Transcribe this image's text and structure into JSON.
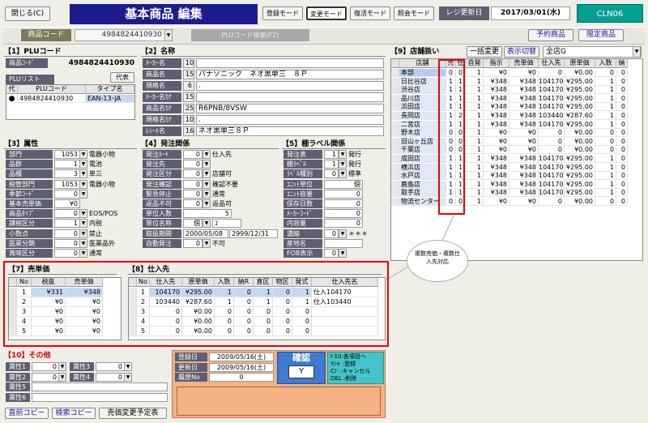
{
  "toolbar": {
    "close": "閉じる(C)",
    "title": "基本商品 編集",
    "modes": [
      "登録モード",
      "変更モード",
      "復活モード",
      "照会モード"
    ],
    "register_date_label": "レジ更新日",
    "register_date": "2017/03/01(水)",
    "user": "CLN06"
  },
  "product_code": {
    "label": "商品コード",
    "value": "4984824410930",
    "search_button": "PLUコード検索(F2)",
    "reserve_button": "予約商品",
    "limited_button": "限定商品"
  },
  "plu": {
    "header": "【1】PLUコード",
    "code_label": "商品ｺｰﾄﾞ",
    "code_value": "4984824410930",
    "list_label": "PLUリスト",
    "rep_label": "代表",
    "columns": [
      "代",
      "PLUコード",
      "タイプ名"
    ],
    "rows": [
      {
        "rep": "●",
        "code": "4984824410930",
        "type": "EAN-13･JA"
      }
    ]
  },
  "names": {
    "header": "【2】名称",
    "rows": [
      {
        "label": "ﾒｰｶｰ名",
        "len": "10",
        "value": ""
      },
      {
        "label": "商品名",
        "len": "15",
        "value": "パナソニック　ネオ黒単三　８Ｐ"
      },
      {
        "label": "規格名",
        "len": "6",
        "value": "."
      },
      {
        "label": "ﾒｰｶｰ名ｶﾅ",
        "len": "15",
        "value": ""
      },
      {
        "label": "商品名ｶﾅ",
        "len": "25",
        "value": "R6PNB/8VSW"
      },
      {
        "label": "規格名ｶﾅ",
        "len": "10",
        "value": "."
      },
      {
        "label": "ﾚｼｰﾄ名",
        "len": "16",
        "value": "ネオ黒単三８Ｐ"
      }
    ]
  },
  "category": {
    "header": "【3】属性",
    "rows": [
      {
        "label": "部門",
        "value": "1053",
        "name": "電器小物"
      },
      {
        "label": "品群",
        "value": "1",
        "name": "電池"
      },
      {
        "label": "品種",
        "value": "3",
        "name": "単三"
      },
      {
        "label": "税管部門",
        "value": "1053",
        "name": "電器小物"
      },
      {
        "label": "季節ｺｰﾄﾞ",
        "value": "0",
        "name": ""
      },
      {
        "label": "基本売単価",
        "value": "¥0",
        "name": ""
      },
      {
        "label": "商品ﾀｲﾌﾟ",
        "value": "0",
        "name": "EOS/POS"
      },
      {
        "label": "課税区分",
        "value": "1",
        "name": "内税"
      },
      {
        "label": "小数点",
        "value": "0",
        "name": "禁止"
      },
      {
        "label": "医薬分類",
        "value": "0",
        "name": "医薬品外"
      },
      {
        "label": "賞味区分",
        "value": "0",
        "name": "通常"
      }
    ]
  },
  "ordering": {
    "header": "【4】発注関係",
    "rows": [
      {
        "label": "発注ﾙｰﾄ",
        "value": "0",
        "text": "仕入先"
      },
      {
        "label": "発注先",
        "value": "0",
        "text": ""
      },
      {
        "label": "発注区分",
        "value": "0",
        "text": "店舗可"
      },
      {
        "label": "発注確認",
        "value": "0",
        "text": "確認不要"
      },
      {
        "label": "緊急停止",
        "value": "0",
        "text": "通常"
      },
      {
        "label": "返品不可",
        "value": "0",
        "text": "返品可"
      },
      {
        "label": "単位入数",
        "value": "5",
        "text": ""
      },
      {
        "label": "単位名称",
        "value": "個",
        "text": "ﾕ"
      },
      {
        "label": "取扱期間",
        "value": "2000/05/08",
        "text": "2999/12/31"
      },
      {
        "label": "自動発注",
        "value": "0",
        "text": "不可"
      }
    ]
  },
  "shelf": {
    "header": "【5】棚ラベル関係",
    "rows": [
      {
        "label": "発注表",
        "value": "1",
        "text": "発行"
      },
      {
        "label": "棚ﾗﾍﾞﾙ",
        "value": "1",
        "text": "発行"
      },
      {
        "label": "ﾗﾍﾞﾙ種別",
        "value": "0",
        "text": "標準"
      },
      {
        "label": "ﾕﾆｯﾄ単位",
        "value": "個",
        "text": ""
      },
      {
        "label": "ﾕﾆｯﾄ容量",
        "value": "0",
        "text": ""
      },
      {
        "label": "保存日数",
        "value": "0",
        "text": ""
      },
      {
        "label": "ﾒｰｶｰｺｰﾄﾞ",
        "value": "0",
        "text": ""
      },
      {
        "label": "内容量",
        "value": "0",
        "text": ""
      },
      {
        "label": "濃縮",
        "value": "0",
        "text": "＊＊＊"
      },
      {
        "label": "産地名",
        "value": "",
        "text": ""
      },
      {
        "label": "FOB表示",
        "value": "0",
        "text": ""
      }
    ]
  },
  "price": {
    "header": "【7】売単価",
    "columns": [
      "No",
      "税抜",
      "売単価"
    ],
    "rows": [
      {
        "no": "1",
        "ex": "¥331",
        "price": "¥348"
      },
      {
        "no": "2",
        "ex": "¥0",
        "price": "¥0"
      },
      {
        "no": "3",
        "ex": "¥0",
        "price": "¥0"
      },
      {
        "no": "4",
        "ex": "¥0",
        "price": "¥0"
      },
      {
        "no": "5",
        "ex": "¥0",
        "price": "¥0"
      }
    ]
  },
  "supplier": {
    "header": "【8】仕入先",
    "columns": [
      "No",
      "仕入先",
      "原単価",
      "入数",
      "納R",
      "直区",
      "物区",
      "発式",
      "仕入先名"
    ],
    "rows": [
      {
        "no": "1",
        "sup": "104170",
        "cost": "¥295.00",
        "qty": "1",
        "r": "0",
        "d": "1",
        "b": "0",
        "h": "1",
        "name": "仕入104170"
      },
      {
        "no": "2",
        "sup": "103440",
        "cost": "¥287.60",
        "qty": "1",
        "r": "0",
        "d": "1",
        "b": "0",
        "h": "1",
        "name": "仕入103440"
      },
      {
        "no": "3",
        "sup": "0",
        "cost": "¥0.00",
        "qty": "0",
        "r": "0",
        "d": "0",
        "b": "0",
        "h": "0",
        "name": ""
      },
      {
        "no": "4",
        "sup": "0",
        "cost": "¥0.00",
        "qty": "0",
        "r": "0",
        "d": "0",
        "b": "0",
        "h": "0",
        "name": ""
      },
      {
        "no": "5",
        "sup": "0",
        "cost": "¥0.00",
        "qty": "0",
        "r": "0",
        "d": "0",
        "b": "0",
        "h": "0",
        "name": ""
      }
    ]
  },
  "stores": {
    "header": "【9】店舗扱い",
    "bulk_button": "一括変更",
    "display_button": "表示切替",
    "group": "全店G",
    "columns": [
      "店舗",
      "売",
      "仕",
      "自発",
      "指示",
      "売単価",
      "仕入先",
      "原単価",
      "入数",
      "納"
    ],
    "rows": [
      {
        "store": "本部",
        "s": "0",
        "b": "0",
        "auto": "1",
        "ins": "¥0",
        "price": "¥0",
        "sup": "0",
        "cost": "¥0.00",
        "qty": "0",
        "n": "0"
      },
      {
        "store": "日比谷店",
        "s": "1",
        "b": "1",
        "auto": "1",
        "ins": "¥348",
        "price": "¥348",
        "sup": "104170",
        "cost": "¥295.00",
        "qty": "1",
        "n": "0"
      },
      {
        "store": "渋谷店",
        "s": "1",
        "b": "1",
        "auto": "1",
        "ins": "¥348",
        "price": "¥348",
        "sup": "104170",
        "cost": "¥295.00",
        "qty": "1",
        "n": "0"
      },
      {
        "store": "品川店",
        "s": "1",
        "b": "1",
        "auto": "1",
        "ins": "¥348",
        "price": "¥348",
        "sup": "104170",
        "cost": "¥295.00",
        "qty": "1",
        "n": "0"
      },
      {
        "store": "浜田店",
        "s": "1",
        "b": "1",
        "auto": "1",
        "ins": "¥348",
        "price": "¥348",
        "sup": "104170",
        "cost": "¥295.00",
        "qty": "1",
        "n": "0"
      },
      {
        "store": "長岡店",
        "s": "1",
        "b": "2",
        "auto": "1",
        "ins": "¥348",
        "price": "¥348",
        "sup": "103440",
        "cost": "¥287.60",
        "qty": "1",
        "n": "0"
      },
      {
        "store": "二宮店",
        "s": "1",
        "b": "1",
        "auto": "1",
        "ins": "¥348",
        "price": "¥348",
        "sup": "104170",
        "cost": "¥295.00",
        "qty": "1",
        "n": "0"
      },
      {
        "store": "野木店",
        "s": "0",
        "b": "0",
        "auto": "1",
        "ins": "¥0",
        "price": "¥0",
        "sup": "0",
        "cost": "¥0.00",
        "qty": "0",
        "n": "0"
      },
      {
        "store": "旧山ヶ丘店",
        "s": "0",
        "b": "0",
        "auto": "1",
        "ins": "¥0",
        "price": "¥0",
        "sup": "0",
        "cost": "¥0.00",
        "qty": "0",
        "n": "0"
      },
      {
        "store": "千葉店",
        "s": "0",
        "b": "0",
        "auto": "1",
        "ins": "¥0",
        "price": "¥0",
        "sup": "0",
        "cost": "¥0.00",
        "qty": "0",
        "n": "0"
      },
      {
        "store": "成田店",
        "s": "1",
        "b": "1",
        "auto": "1",
        "ins": "¥348",
        "price": "¥348",
        "sup": "104170",
        "cost": "¥295.00",
        "qty": "1",
        "n": "0"
      },
      {
        "store": "横浜店",
        "s": "1",
        "b": "1",
        "auto": "1",
        "ins": "¥348",
        "price": "¥348",
        "sup": "104170",
        "cost": "¥295.00",
        "qty": "1",
        "n": "0"
      },
      {
        "store": "水戸店",
        "s": "1",
        "b": "1",
        "auto": "1",
        "ins": "¥348",
        "price": "¥348",
        "sup": "104170",
        "cost": "¥295.00",
        "qty": "1",
        "n": "0"
      },
      {
        "store": "鹿島店",
        "s": "1",
        "b": "1",
        "auto": "1",
        "ins": "¥348",
        "price": "¥348",
        "sup": "104170",
        "cost": "¥295.00",
        "qty": "1",
        "n": "0"
      },
      {
        "store": "取手店",
        "s": "1",
        "b": "1",
        "auto": "1",
        "ins": "¥348",
        "price": "¥348",
        "sup": "104170",
        "cost": "¥295.00",
        "qty": "1",
        "n": "0"
      },
      {
        "store": "物流センター",
        "s": "0",
        "b": "0",
        "auto": "1",
        "ins": "¥0",
        "price": "¥0",
        "sup": "0",
        "cost": "¥0.00",
        "qty": "0",
        "n": "0"
      }
    ]
  },
  "callout": "複数売価・複数仕入先対応",
  "other": {
    "header": "【10】その他",
    "rows": [
      {
        "label": "属性1",
        "value": "0",
        "label2": "属性3",
        "value2": "0"
      },
      {
        "label": "属性2",
        "value": "0",
        "label2": "属性4",
        "value2": "0"
      },
      {
        "label": "属性5",
        "value": "",
        "label2": "",
        "value2": ""
      },
      {
        "label": "属性6",
        "value": "",
        "label2": "",
        "value2": ""
      }
    ],
    "prev_copy": "直前コピー",
    "search_copy": "検索コピー",
    "price_change": "売価変更予定表"
  },
  "dates": {
    "rows": [
      {
        "label": "登録日",
        "value": "2009/05/16(土)"
      },
      {
        "label": "更新日",
        "value": "2009/05/16(土)"
      },
      {
        "label": "履歴No",
        "value": "0"
      }
    ]
  },
  "confirm": {
    "label": "確認",
    "value": "Y"
  },
  "help": [
    "I-10:各項目へ",
    "Y/+ :登録",
    "C/- :キャンセル",
    "DEL :削除"
  ],
  "colors": {
    "accent": "#1c1c8c",
    "label_bg": "#5e5e72",
    "highlight": "#e00000",
    "orange": "#f4b183",
    "cyan": "#44c4c8",
    "green": "#00a090"
  }
}
